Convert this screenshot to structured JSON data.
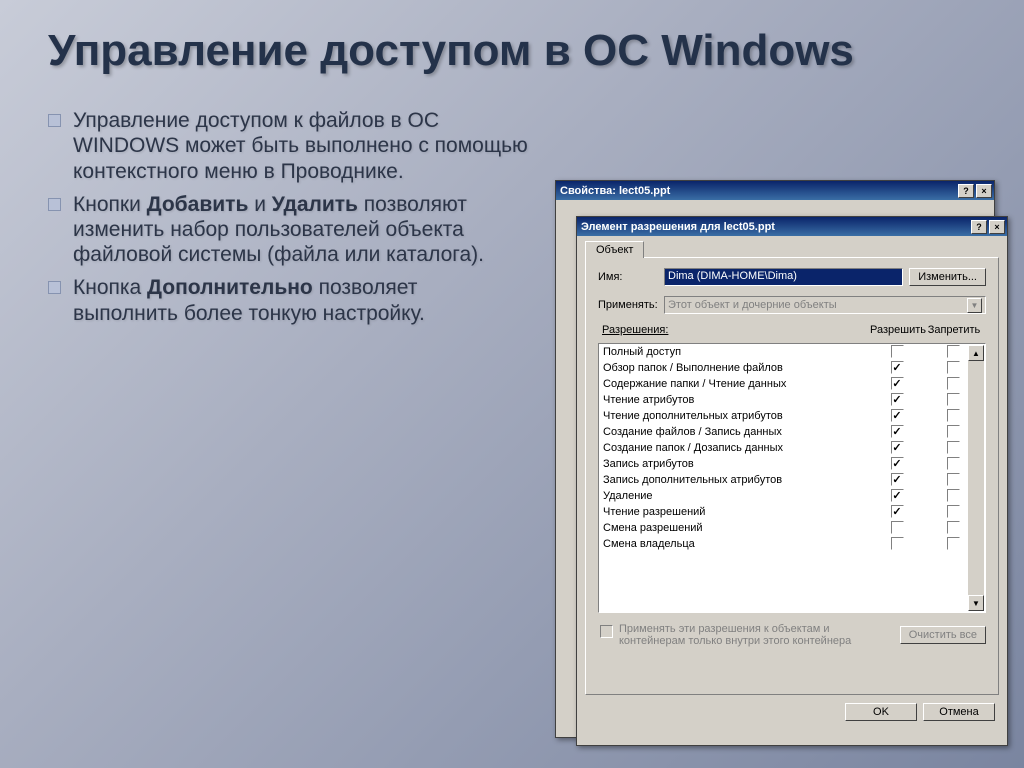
{
  "slide": {
    "title": "Управление доступом в ОС Windows",
    "bullets": [
      {
        "pre": "Управление доступом к файлов в ОС WINDOWS может быть выполнено с помощью контекстного меню в Проводнике.",
        "bold": "",
        "post": ""
      },
      {
        "pre": "Кнопки ",
        "bold": "Добавить",
        "mid": " и ",
        "bold2": "Удалить",
        "post": " позволяют изменить набор пользователей объекта файловой системы (файла или каталога)."
      },
      {
        "pre": "Кнопка ",
        "bold": "Дополнительно",
        "post": " позволяет выполнить более тонкую настройку."
      }
    ]
  },
  "back_dialog": {
    "title": "Свойства: lect05.ppt"
  },
  "front_dialog": {
    "title": "Элемент разрешения для lect05.ppt",
    "tab": "Объект",
    "name_label": "Имя:",
    "name_value": "Dima (DIMA-HOME\\Dima)",
    "change_btn": "Изменить...",
    "apply_label": "Применять:",
    "apply_value": "Этот объект и дочерние объекты",
    "perm_header": "Разрешения:",
    "allow_header": "Разрешить",
    "deny_header": "Запретить",
    "permissions": [
      {
        "name": "Полный доступ",
        "allow": false,
        "deny": false
      },
      {
        "name": "Обзор папок / Выполнение файлов",
        "allow": true,
        "deny": false
      },
      {
        "name": "Содержание папки / Чтение данных",
        "allow": true,
        "deny": false
      },
      {
        "name": "Чтение атрибутов",
        "allow": true,
        "deny": false
      },
      {
        "name": "Чтение дополнительных атрибутов",
        "allow": true,
        "deny": false
      },
      {
        "name": "Создание файлов / Запись данных",
        "allow": true,
        "deny": false
      },
      {
        "name": "Создание папок / Дозапись данных",
        "allow": true,
        "deny": false
      },
      {
        "name": "Запись атрибутов",
        "allow": true,
        "deny": false
      },
      {
        "name": "Запись дополнительных атрибутов",
        "allow": true,
        "deny": false
      },
      {
        "name": "Удаление",
        "allow": true,
        "deny": false
      },
      {
        "name": "Чтение разрешений",
        "allow": true,
        "deny": false
      },
      {
        "name": "Смена разрешений",
        "allow": false,
        "deny": false
      },
      {
        "name": "Смена владельца",
        "allow": false,
        "deny": false
      }
    ],
    "inherit_note": "Применять эти разрешения к объектам и контейнерам только внутри этого контейнера",
    "clear_btn": "Очистить все",
    "ok_btn": "OK",
    "cancel_btn": "Отмена"
  }
}
